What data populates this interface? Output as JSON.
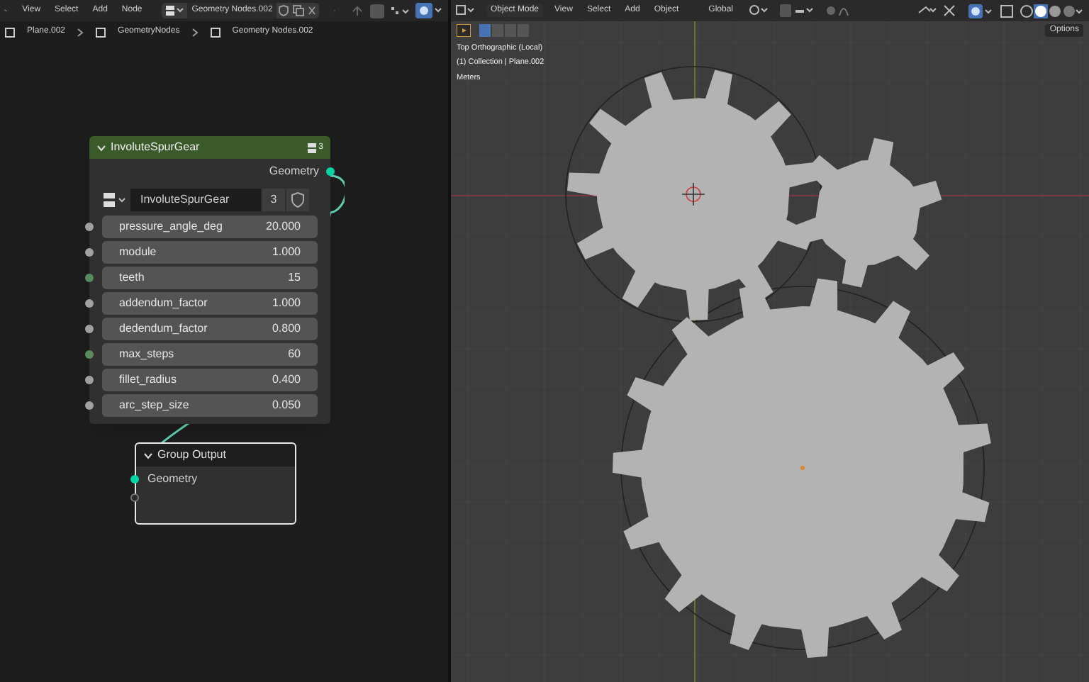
{
  "node_editor": {
    "header": {
      "menus": [
        "View",
        "Select",
        "Add",
        "Node"
      ],
      "tree_name": "Geometry Nodes.002"
    },
    "breadcrumbs": [
      "Plane.002",
      "GeometryNodes",
      "Geometry Nodes.002"
    ],
    "gear_node": {
      "title": "InvoluteSpurGear",
      "user_count": "3",
      "output": "Geometry",
      "group_name": "InvoluteSpurGear",
      "group_users": "3",
      "inputs": [
        {
          "name": "pressure_angle_deg",
          "value": "20.000",
          "kind": "float"
        },
        {
          "name": "module",
          "value": "1.000",
          "kind": "float"
        },
        {
          "name": "teeth",
          "value": "15",
          "kind": "int"
        },
        {
          "name": "addendum_factor",
          "value": "1.000",
          "kind": "float"
        },
        {
          "name": "dedendum_factor",
          "value": "0.800",
          "kind": "float"
        },
        {
          "name": "max_steps",
          "value": "60",
          "kind": "int"
        },
        {
          "name": "fillet_radius",
          "value": "0.400",
          "kind": "float"
        },
        {
          "name": "arc_step_size",
          "value": "0.050",
          "kind": "float"
        }
      ]
    },
    "output_node": {
      "title": "Group Output",
      "input": "Geometry",
      "selected": true
    }
  },
  "viewport": {
    "header": {
      "mode": "Object Mode",
      "menus": [
        "View",
        "Select",
        "Add",
        "Object"
      ],
      "orientation": "Global"
    },
    "options": "Options",
    "overlay": [
      "Top Orthographic (Local)",
      "(1) Collection | Plane.002",
      "Meters"
    ]
  }
}
